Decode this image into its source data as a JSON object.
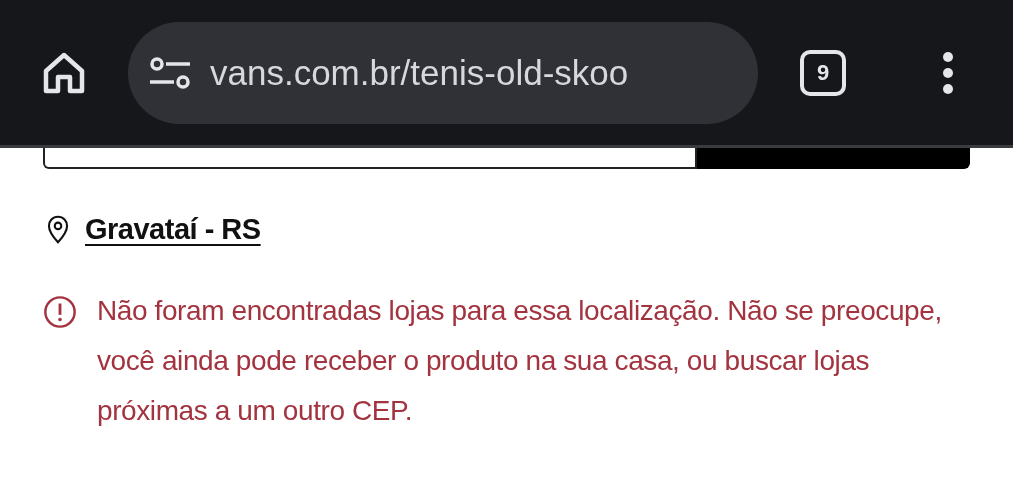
{
  "browser": {
    "url": "vans.com.br/tenis-old-skoo",
    "tab_count": "9"
  },
  "location": {
    "label": "Gravataí - RS"
  },
  "alert": {
    "message": "Não foram encontradas lojas para essa localização. Não se preocupe, você ainda pode receber o produto na sua casa, ou buscar lojas próximas a um outro CEP."
  }
}
